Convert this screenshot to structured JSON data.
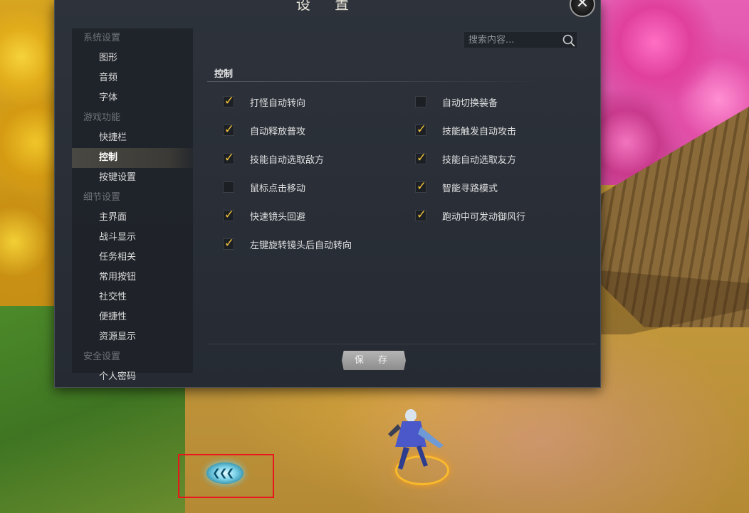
{
  "dialog": {
    "title": "设 置",
    "close_icon": "close-icon",
    "save_label": "保 存",
    "search": {
      "placeholder": "搜索内容...",
      "icon": "search-icon"
    }
  },
  "sidebar": {
    "groups": [
      {
        "label": "系统设置",
        "items": [
          "图形",
          "音频",
          "字体"
        ]
      },
      {
        "label": "游戏功能",
        "items": [
          "快捷栏",
          "控制",
          "按键设置"
        ]
      },
      {
        "label": "细节设置",
        "items": [
          "主界面",
          "战斗显示",
          "任务相关",
          "常用按钮",
          "社交性",
          "便捷性",
          "资源显示"
        ]
      },
      {
        "label": "安全设置",
        "items": [
          "个人密码"
        ]
      }
    ],
    "active_item": "控制"
  },
  "section": {
    "title": "控制",
    "options": [
      {
        "label": "打怪自动转向",
        "checked": true
      },
      {
        "label": "自动切换装备",
        "checked": false
      },
      {
        "label": "自动释放普攻",
        "checked": true
      },
      {
        "label": "技能触发自动攻击",
        "checked": true
      },
      {
        "label": "技能自动选取敌方",
        "checked": true
      },
      {
        "label": "技能自动选取友方",
        "checked": true
      },
      {
        "label": "鼠标点击移动",
        "checked": false
      },
      {
        "label": "智能寻路模式",
        "checked": true
      },
      {
        "label": "快速镜头回避",
        "checked": true
      },
      {
        "label": "跑动中可发动御风行",
        "checked": true
      },
      {
        "label": "左键旋转镜头后自动转向",
        "checked": true
      }
    ]
  },
  "colors": {
    "checkmark": "#f2c33a",
    "annotation": "#e8171d",
    "dialog_bg": "#2b3038"
  }
}
